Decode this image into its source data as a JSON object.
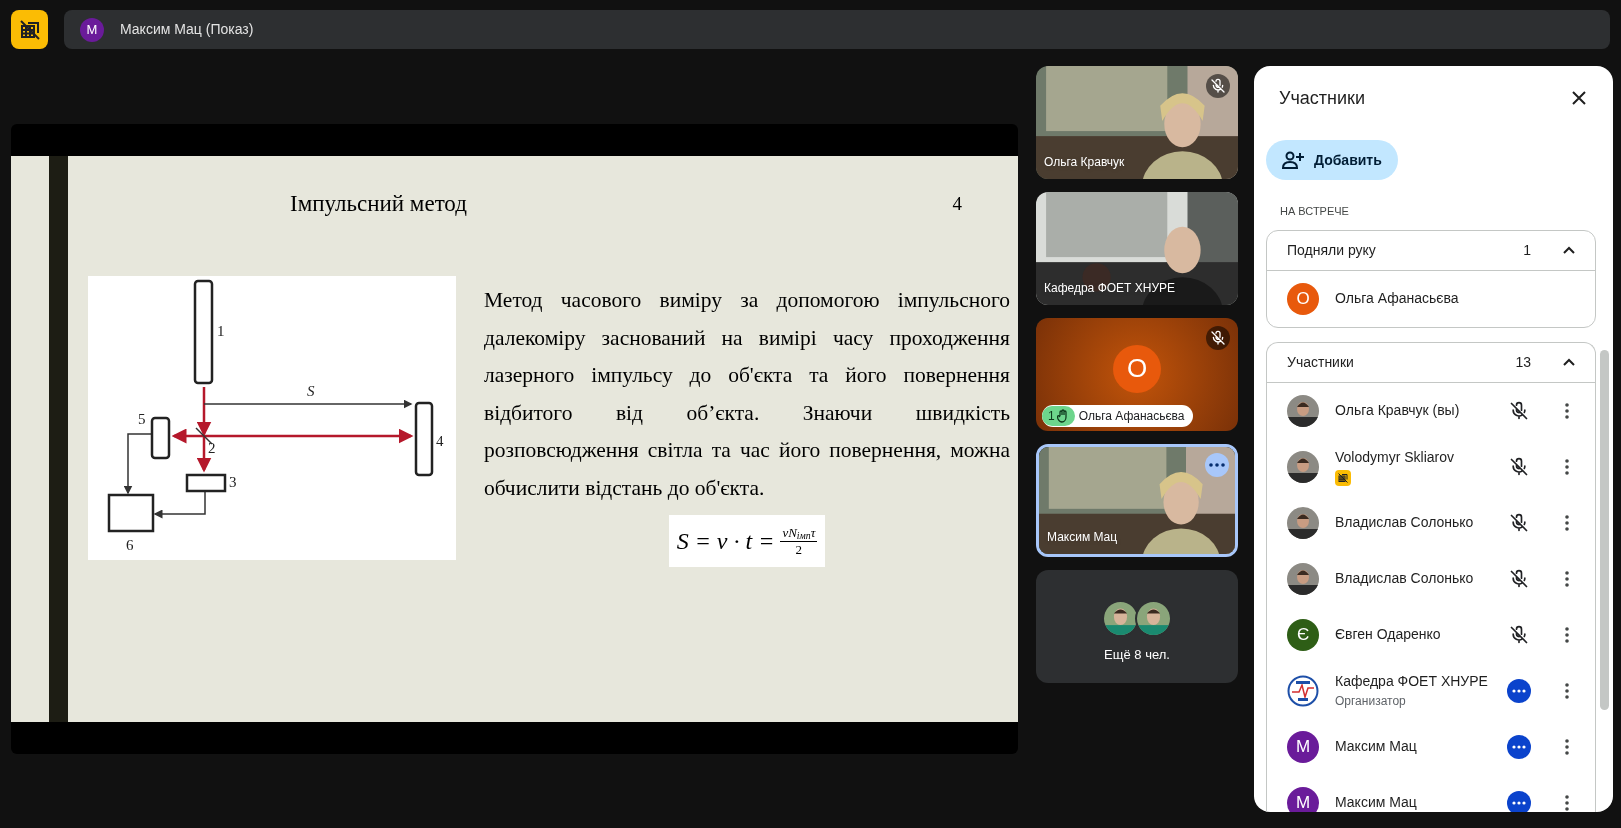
{
  "presenter_bar": {
    "avatar_letter": "M",
    "label": "Максим Мац (Показ)"
  },
  "slide": {
    "title": "Імпульсний метод",
    "number": "4",
    "diagram_labels": [
      "1",
      "2",
      "3",
      "4",
      "5",
      "6",
      "S"
    ],
    "paragraph": "Метод часового виміру за допомогою імпульсного далекоміру заснований на вимірі часу проходження лазерного імпульсу до об'єкта та його повернення відбитого від об’єкта. Знаючи швидкість розповсюдження світла та час його повернення, можна обчислити відстань до об'єкта.",
    "formula": {
      "left": "S = v · t =",
      "numerator": "vN$_{імп}$τ",
      "denominator": "2"
    }
  },
  "tiles": [
    {
      "kind": "video",
      "name": "Ольга Кравчук",
      "muted": true,
      "highlighted": false
    },
    {
      "kind": "video",
      "name": "Кафедра ФОЕТ ХНУРЕ",
      "muted": false,
      "highlighted": false
    },
    {
      "kind": "avatar",
      "name": "Ольга Афанасьєва",
      "letter": "О",
      "color": "#e8590c",
      "muted": true,
      "hand": "1",
      "highlighted": false
    },
    {
      "kind": "video",
      "name": "Максим Мац",
      "muted": false,
      "highlighted": true
    },
    {
      "kind": "more",
      "label": "Ещё 8 чел."
    }
  ],
  "panel": {
    "title": "Участники",
    "add_button": "Добавить",
    "section_label": "НА ВСТРЕЧЕ",
    "groups": [
      {
        "title": "Подняли руку",
        "count": "1",
        "expanded": true,
        "people": [
          {
            "name": "Ольга Афанасьєва",
            "avatar": {
              "kind": "letter",
              "letter": "О",
              "color": "#e8590c"
            }
          }
        ]
      },
      {
        "title": "Участники",
        "count": "13",
        "expanded": true,
        "people": [
          {
            "name": "Ольга Кравчук (вы)",
            "muted": true
          },
          {
            "name": "Volodymyr Skliarov",
            "muted": true,
            "presenting": true
          },
          {
            "name": "Владислав Солонько",
            "muted": true
          },
          {
            "name": "Владислав Солонько",
            "muted": true
          },
          {
            "name": "Євген Одаренко",
            "avatar": {
              "kind": "letter",
              "letter": "Є",
              "color": "#2e5e16"
            },
            "muted": true
          },
          {
            "name": "Кафедра ФОЕТ ХНУРЕ",
            "role": "Организатор",
            "avatar": {
              "kind": "logo"
            },
            "muted": false
          },
          {
            "name": "Максим Мац",
            "avatar": {
              "kind": "letter",
              "letter": "M",
              "color": "#6a1b9a"
            },
            "muted": false
          },
          {
            "name": "Максим Мац",
            "avatar": {
              "kind": "letter",
              "letter": "M",
              "color": "#6a1b9a"
            },
            "muted": false
          }
        ]
      }
    ]
  }
}
